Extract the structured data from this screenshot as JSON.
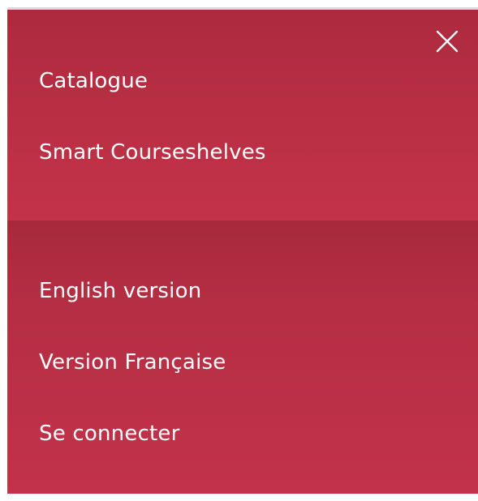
{
  "menu": {
    "close_icon": "close-icon",
    "primary_links": [
      {
        "label": "Catalogue"
      },
      {
        "label": "Smart Courseshelves"
      }
    ],
    "secondary_links": [
      {
        "label": "English version"
      },
      {
        "label": "Version Française"
      },
      {
        "label": "Se connecter"
      }
    ]
  },
  "colors": {
    "panel_red": "#ba2f44",
    "divider_red": "#a8293c",
    "text": "#ffffff"
  }
}
